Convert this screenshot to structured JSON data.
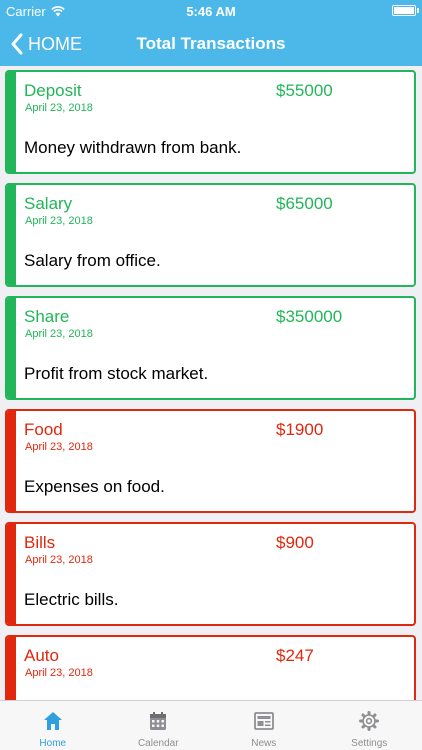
{
  "status": {
    "carrier": "Carrier",
    "time": "5:46 AM"
  },
  "nav": {
    "back_label": "HOME",
    "title": "Total Transactions"
  },
  "transactions": [
    {
      "name": "Deposit",
      "date": "April 23, 2018",
      "amount": "$55000",
      "description": "Money withdrawn from bank.",
      "kind": "income"
    },
    {
      "name": "Salary",
      "date": "April 23, 2018",
      "amount": "$65000",
      "description": "Salary from office.",
      "kind": "income"
    },
    {
      "name": "Share",
      "date": "April 23, 2018",
      "amount": "$350000",
      "description": "Profit from stock market.",
      "kind": "income"
    },
    {
      "name": "Food",
      "date": "April 23, 2018",
      "amount": "$1900",
      "description": "Expenses on food.",
      "kind": "expense"
    },
    {
      "name": "Bills",
      "date": "April 23, 2018",
      "amount": "$900",
      "description": "Electric bills.",
      "kind": "expense"
    },
    {
      "name": "Auto",
      "date": "April 23, 2018",
      "amount": "$247",
      "description": "",
      "kind": "expense"
    }
  ],
  "colors": {
    "income": "#22b559",
    "expense": "#e0280e",
    "accent": "#4cb8ea",
    "tab_active": "#2f9fe0"
  },
  "tabs": [
    {
      "label": "Home",
      "icon": "home-icon",
      "active": true
    },
    {
      "label": "Calendar",
      "icon": "calendar-icon",
      "active": false
    },
    {
      "label": "News",
      "icon": "news-icon",
      "active": false
    },
    {
      "label": "Settings",
      "icon": "gear-icon",
      "active": false
    }
  ]
}
